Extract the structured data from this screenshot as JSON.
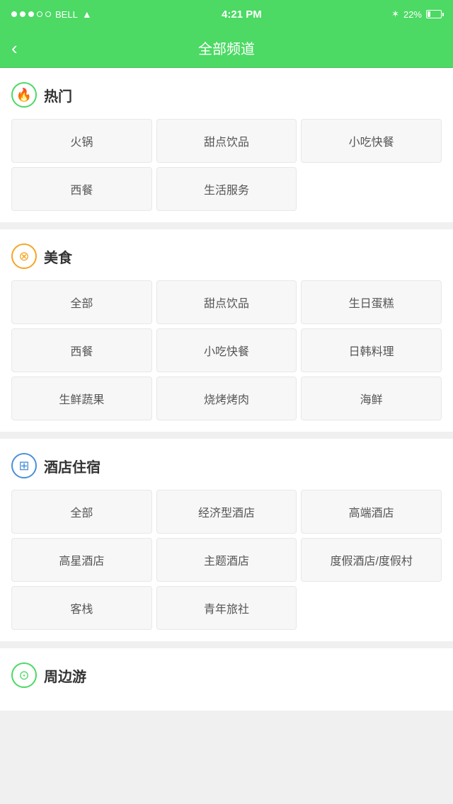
{
  "statusBar": {
    "carrier": "BELL",
    "time": "4:21 PM",
    "battery": "22%"
  },
  "navBar": {
    "backLabel": "‹",
    "title": "全部频道"
  },
  "sections": [
    {
      "id": "hot",
      "iconType": "hot",
      "iconSymbol": "🔥",
      "title": "热门",
      "items": [
        "火锅",
        "甜点饮品",
        "小吃快餐",
        "西餐",
        "生活服务"
      ]
    },
    {
      "id": "food",
      "iconType": "food",
      "iconSymbol": "✕",
      "title": "美食",
      "items": [
        "全部",
        "甜点饮品",
        "生日蛋糕",
        "西餐",
        "小吃快餐",
        "日韩料理",
        "生鲜蔬果",
        "烧烤烤肉",
        "海鲜"
      ]
    },
    {
      "id": "hotel",
      "iconType": "hotel",
      "iconSymbol": "⊞",
      "title": "酒店住宿",
      "items": [
        "全部",
        "经济型酒店",
        "高端酒店",
        "高星酒店",
        "主题酒店",
        "度假酒店/度假村",
        "客栈",
        "青年旅社"
      ]
    },
    {
      "id": "travel",
      "iconType": "travel",
      "iconSymbol": "⊙",
      "title": "周边游",
      "items": []
    }
  ]
}
